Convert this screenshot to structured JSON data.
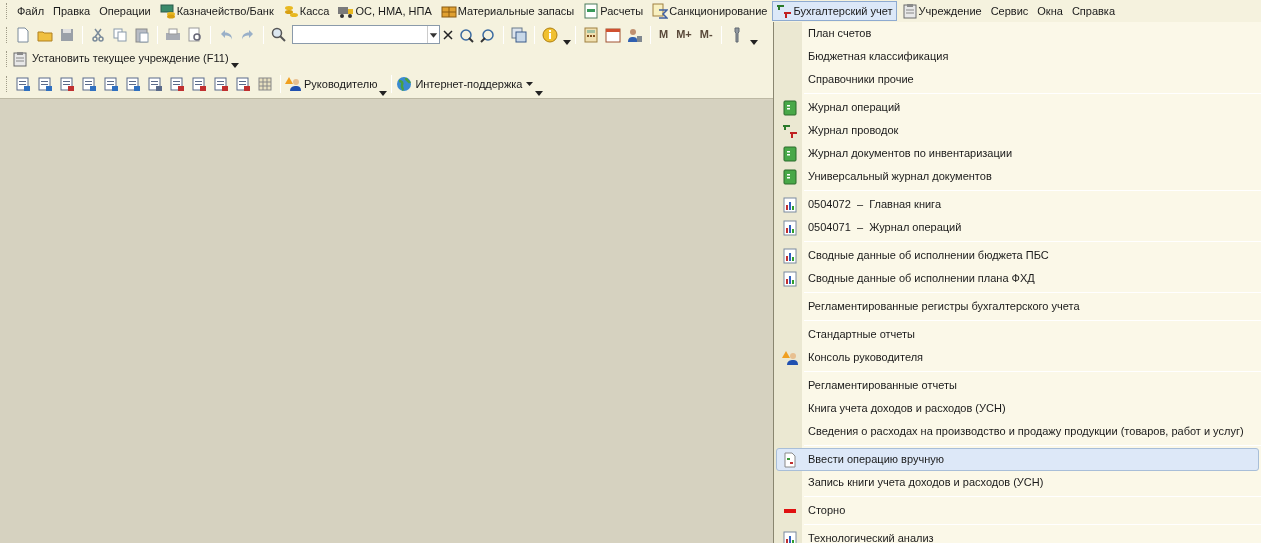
{
  "menubar": [
    {
      "label": "Файл",
      "kind": "plain",
      "selected": false
    },
    {
      "label": "Правка",
      "kind": "plain",
      "selected": false
    },
    {
      "label": "Операции",
      "kind": "plain",
      "selected": false
    },
    {
      "label": "Казначейство/Банк",
      "kind": "treasury",
      "selected": false
    },
    {
      "label": "Касса",
      "kind": "coins",
      "selected": false
    },
    {
      "label": "ОС, НМА, НПА",
      "kind": "truck",
      "selected": false
    },
    {
      "label": "Материальные запасы",
      "kind": "boxes",
      "selected": false
    },
    {
      "label": "Расчеты",
      "kind": "doc",
      "selected": false
    },
    {
      "label": "Санкционирование",
      "kind": "sigma",
      "selected": false
    },
    {
      "label": "Бухгалтерский учет",
      "kind": "dtkt",
      "selected": true
    },
    {
      "label": "Учреждение",
      "kind": "clipboard",
      "selected": false
    },
    {
      "label": "Сервис",
      "kind": "plain",
      "selected": false
    },
    {
      "label": "Окна",
      "kind": "plain",
      "selected": false
    },
    {
      "label": "Справка",
      "kind": "plain",
      "selected": false
    }
  ],
  "toolbar": {
    "memory_buttons": [
      "M",
      "M+",
      "M-"
    ],
    "institution_button": "Установить текущее учреждение (F11)",
    "leader_button": "Руководителю",
    "support_button": "Интернет-поддержка"
  },
  "dropdown_menu": [
    [
      {
        "label": "План счетов",
        "kind": "plain",
        "selected": false
      },
      {
        "label": "Бюджетная классификация",
        "kind": "plain",
        "selected": false
      },
      {
        "label": "Справочники прочие",
        "kind": "plain",
        "selected": false
      }
    ],
    [
      {
        "label": "Журнал операций",
        "kind": "journal",
        "selected": false
      },
      {
        "label": "Журнал проводок",
        "kind": "dtkt",
        "selected": false
      },
      {
        "label": "Журнал документов по инвентаризации",
        "kind": "journal",
        "selected": false
      },
      {
        "label": "Универсальный журнал документов",
        "kind": "journal",
        "selected": false
      }
    ],
    [
      {
        "label": "0504072  –  Главная книга",
        "kind": "report",
        "selected": false
      },
      {
        "label": "0504071  –  Журнал операций",
        "kind": "report",
        "selected": false
      }
    ],
    [
      {
        "label": "Сводные данные об исполнении бюджета ПБС",
        "kind": "report",
        "selected": false
      },
      {
        "label": "Сводные данные об исполнении плана ФХД",
        "kind": "report",
        "selected": false
      }
    ],
    [
      {
        "label": "Регламентированные регистры бухгалтерского учета",
        "kind": "plain",
        "selected": false
      }
    ],
    [
      {
        "label": "Стандартные отчеты",
        "kind": "plain",
        "selected": false
      },
      {
        "label": "Консоль руководителя",
        "kind": "leader",
        "selected": false
      }
    ],
    [
      {
        "label": "Регламентированные отчеты",
        "kind": "plain",
        "selected": false
      },
      {
        "label": "Книга учета доходов и расходов (УСН)",
        "kind": "plain",
        "selected": false
      },
      {
        "label": "Сведения о расходах на производство и продажу продукции (товаров, работ и услуг)",
        "kind": "plain",
        "selected": false
      }
    ],
    [
      {
        "label": "Ввести операцию вручную",
        "kind": "manual",
        "selected": true
      },
      {
        "label": "Запись книги учета доходов и расходов (УСН)",
        "kind": "plain",
        "selected": false
      }
    ],
    [
      {
        "label": "Сторно",
        "kind": "storno",
        "selected": false
      }
    ],
    [
      {
        "label": "Технологический анализ",
        "kind": "report",
        "selected": false
      }
    ]
  ]
}
